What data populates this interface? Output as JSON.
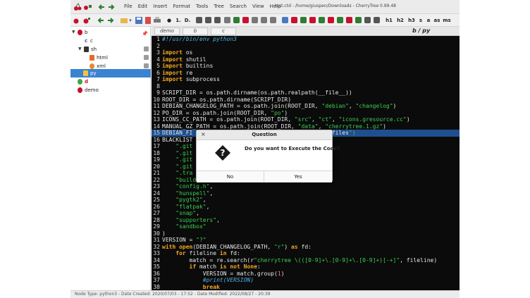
{
  "menu": [
    "File",
    "Edit",
    "Insert",
    "Format",
    "Tools",
    "Tree",
    "Search",
    "View",
    "Help"
  ],
  "window_title": "test.ctd - /home/giuspen/Downloads - CherryTree 0.99.48",
  "toolbar": {
    "labels": [
      "1.",
      "D.",
      "h1",
      "h2",
      "h3",
      "s",
      "a",
      "as",
      "ms"
    ]
  },
  "tree": {
    "items": [
      {
        "label": "b"
      },
      {
        "label": "c"
      },
      {
        "label": "sh"
      },
      {
        "label": "html"
      },
      {
        "label": "xml"
      },
      {
        "label": "py"
      },
      {
        "label": "d"
      },
      {
        "label": "demo"
      }
    ]
  },
  "tabs": [
    "demo",
    "b",
    "c"
  ],
  "node_title": "b / py",
  "code_lines": [
    "1 #!/usr/bin/env python3",
    "2",
    "3 import os",
    "4 import shutil",
    "5 import builtins",
    "6 import re",
    "7 import subprocess",
    "8",
    "9 SCRIPT_DIR = os.path.dirname(os.path.realpath(__file__))",
    "10 ROOT_DIR = os.path.dirname(SCRIPT_DIR)",
    "11 DEBIAN_CHANGELOG_PATH = os.path.join(ROOT_DIR, \"debian\", \"changelog\")",
    "12 PO_DIR = os.path.join(ROOT_DIR, \"po\")",
    "13 ICONS_CC_PATH = os.path.join(ROOT_DIR, \"src\", \"ct\", \"icons.gresource.cc\")",
    "14 MANUAL_GZ_PATH = os.path.join(ROOT_DIR, \"data\", \"cherrytree.1.gz\")",
    "15 DEBIAN_FI                                  ian\", \"files\")",
    "16 BLACKLIST",
    "17     \".git",
    "18     \".git",
    "19     \".git",
    "20     \".git",
    "21     \".tra",
    "22     \"build\",",
    "23     \"config.h\",",
    "24     \"hunspell\",",
    "25     \"pygtk2\",",
    "26     \"flatpak\",",
    "27     \"snap\",",
    "28     \"supporters\",",
    "29     \"sandbox\"",
    "30 )",
    "31 VERSION = \"?\"",
    "32 with open(DEBIAN_CHANGELOG_PATH, \"r\") as fd:",
    "33     for fileline in fd:",
    "34         match = re.search(r\"cherrytree \\(([0-9]+\\.[0-9]+\\.[0-9]+)[-+]\", fileline)",
    "35         if match is not None:",
    "36             VERSION = match.group(1)",
    "37             #print(VERSION)",
    "38             break"
  ],
  "status_bar": "Node Type: python3  -  Date Created: 2020/07/03 - 17:52  -  Date Modified: 2022/08/27 - 20:39",
  "dialog": {
    "title": "Question",
    "close_label": "×",
    "message": "Do you want to Execute the Code?",
    "no_label": "No",
    "yes_label": "Yes",
    "icon_glyph": "?"
  },
  "colors": {
    "selection": "#3b82d1",
    "editor_bg": "#0b0b0b",
    "highlight_line": "#1f4f8f",
    "string": "#3ad050",
    "keyword": "#f5a623",
    "comment": "#4fb3e6"
  }
}
